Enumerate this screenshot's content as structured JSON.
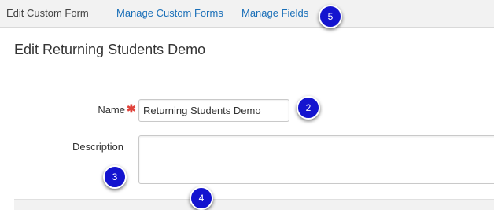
{
  "tabs": [
    {
      "label": "Edit Custom Form",
      "active": true
    },
    {
      "label": "Manage Custom Forms",
      "active": false
    },
    {
      "label": "Manage Fields",
      "active": false
    }
  ],
  "page_title": "Edit Returning Students Demo",
  "form": {
    "name_label": "Name",
    "required_mark": "✱",
    "name_value": "Returning Students Demo",
    "description_label": "Description",
    "description_value": ""
  },
  "badges": {
    "b2": "2",
    "b3": "3",
    "b4": "4",
    "b5": "5"
  },
  "colors": {
    "link": "#1a6fb8",
    "badge": "#1414cf",
    "required": "#e0433b"
  }
}
